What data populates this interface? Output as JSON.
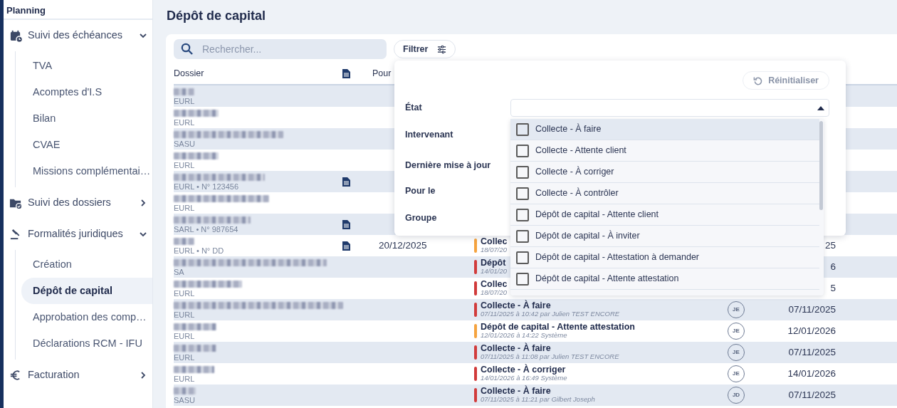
{
  "sidebar": {
    "title": "Planning",
    "sections": [
      {
        "kind": "calendar",
        "label": "Suivi des échéances",
        "expanded": true,
        "items": [
          {
            "label": "TVA",
            "selected": false
          },
          {
            "label": "Acomptes d'I.S",
            "selected": false
          },
          {
            "label": "Bilan",
            "selected": false
          },
          {
            "label": "CVAE",
            "selected": false
          },
          {
            "label": "Missions complémentai…",
            "selected": false
          }
        ]
      },
      {
        "kind": "folder",
        "label": "Suivi des dossiers",
        "expanded": false
      },
      {
        "kind": "gavel",
        "label": "Formalités juridiques",
        "expanded": true,
        "items": [
          {
            "label": "Création",
            "selected": false
          },
          {
            "label": "Dépôt de capital",
            "selected": true
          },
          {
            "label": "Approbation des comp…",
            "selected": false
          },
          {
            "label": "Déclarations RCM - IFU",
            "selected": false
          }
        ]
      },
      {
        "kind": "euro",
        "label": "Facturation",
        "expanded": false
      }
    ]
  },
  "page": {
    "title": "Dépôt de capital"
  },
  "toolbar": {
    "search": {
      "placeholder": "Rechercher..."
    },
    "filter_button": "Filtrer"
  },
  "table": {
    "columns": [
      {
        "kind": "text",
        "label": "Dossier"
      },
      {
        "kind": "icon"
      },
      {
        "kind": "text",
        "label": "Pour"
      }
    ],
    "rows": [
      {
        "type": "EURL",
        "document": false
      },
      {
        "type": "EURL",
        "document": false
      },
      {
        "type": "SASU",
        "document": false
      },
      {
        "type": "EURL",
        "document": false
      },
      {
        "type": "EURL • N° 123456",
        "document": true
      },
      {
        "type": "EURL",
        "document": false
      },
      {
        "type": "SARL • N° 987654",
        "document": true
      },
      {
        "type": "EURL • N° DD",
        "document": true,
        "pour_le": "20/12/2025",
        "status": "Collec",
        "status_info": "18/07/20",
        "color": "#f5a33f",
        "date": "25"
      },
      {
        "type": "SA",
        "document": false,
        "status": "Dépôt",
        "status_info": "14/01/20",
        "color": "#d13b3b",
        "date": "6"
      },
      {
        "type": "EURL",
        "document": false,
        "status": "Collec",
        "status_info": "18/07/20",
        "color": "#d13b3b",
        "date": "5"
      },
      {
        "type": "EURL",
        "document": false,
        "status": "Collecte - À faire",
        "status_info": "07/11/2025 à 10:42 par Julien TEST ENCORE",
        "color": "#d13b3b",
        "assignee": "JE",
        "date": "07/11/2025"
      },
      {
        "type": "EURL",
        "document": false,
        "status": "Dépôt de capital - Attente attestation",
        "status_info": "12/01/2026 à 14:22 Système",
        "color": "#f5a33f",
        "assignee": "JE",
        "date": "12/01/2026"
      },
      {
        "type": "EURL",
        "document": false,
        "status": "Collecte - À faire",
        "status_info": "07/11/2025 à 11:08 par Julien TEST ENCORE",
        "color": "#d13b3b",
        "assignee": "JE",
        "date": "07/11/2025"
      },
      {
        "type": "EURL",
        "document": false,
        "status": "Collecte - À corriger",
        "status_info": "14/01/2026 à 16:49 Système",
        "color": "#d13b3b",
        "assignee": "JE",
        "date": "14/01/2026"
      },
      {
        "type": "SASU",
        "document": false,
        "status": "Collecte - À faire",
        "status_info": "07/11/2025 à 11:21 par Gilbert Joseph",
        "color": "#d13b3b",
        "assignee": "JD",
        "date": "07/11/2025"
      }
    ]
  },
  "filter_panel": {
    "reset_button": "Réinitialiser",
    "fields": [
      "État",
      "Intervenant",
      "Dernière mise à jour",
      "Pour le",
      "Groupe"
    ],
    "state_options": [
      {
        "label": "Collecte - À faire",
        "checked": false,
        "highlighted": true
      },
      {
        "label": "Collecte - Attente client",
        "checked": false,
        "highlighted": false
      },
      {
        "label": "Collecte - À corriger",
        "checked": false,
        "highlighted": false
      },
      {
        "label": "Collecte - À contrôler",
        "checked": false,
        "highlighted": false
      },
      {
        "label": "Dépôt de capital - Attente client",
        "checked": false,
        "highlighted": false
      },
      {
        "label": "Dépôt de capital - À inviter",
        "checked": false,
        "highlighted": false
      },
      {
        "label": "Dépôt de capital - Attestation à demander",
        "checked": false,
        "highlighted": false
      },
      {
        "label": "Dépôt de capital - Attente attestation",
        "checked": false,
        "highlighted": false
      }
    ]
  }
}
